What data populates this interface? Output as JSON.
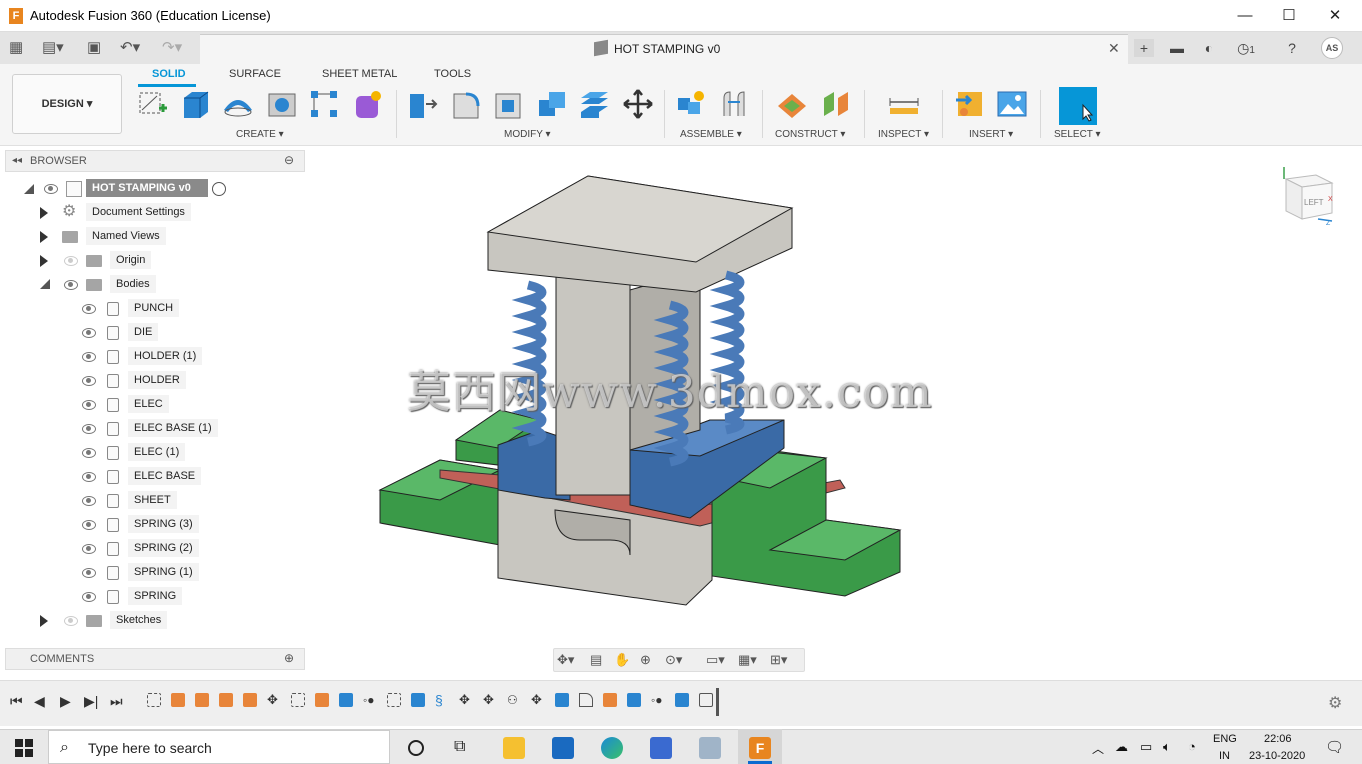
{
  "window": {
    "title": "Autodesk Fusion 360 (Education License)",
    "minimize": "—",
    "maximize": "☐",
    "close": "✕"
  },
  "document": {
    "title": "HOT STAMPING v0",
    "close": "✕"
  },
  "header": {
    "user_initials": "AS",
    "notifications_count": "1"
  },
  "workspace": {
    "label": "DESIGN ▾"
  },
  "tabs": [
    {
      "label": "SOLID"
    },
    {
      "label": "SURFACE"
    },
    {
      "label": "SHEET METAL"
    },
    {
      "label": "TOOLS"
    }
  ],
  "groups": {
    "create": "CREATE ▾",
    "modify": "MODIFY ▾",
    "assemble": "ASSEMBLE ▾",
    "construct": "CONSTRUCT ▾",
    "inspect": "INSPECT ▾",
    "insert": "INSERT ▾",
    "select": "SELECT ▾"
  },
  "browser": {
    "title": "BROWSER",
    "root": "HOT STAMPING v0",
    "nodes": {
      "document_settings": "Document Settings",
      "named_views": "Named Views",
      "origin": "Origin",
      "bodies": "Bodies",
      "sketches": "Sketches"
    },
    "bodies": [
      "PUNCH",
      "DIE",
      "HOLDER (1)",
      "HOLDER",
      "ELEC",
      "ELEC BASE (1)",
      "ELEC (1)",
      "ELEC BASE",
      "SHEET",
      "SPRING (3)",
      "SPRING (2)",
      "SPRING (1)",
      "SPRING"
    ]
  },
  "comments": {
    "title": "COMMENTS"
  },
  "viewcube": {
    "face": "LEFT",
    "axis_x": "X",
    "axis_z": "Z"
  },
  "watermark": "莫西网www.3dmox.com",
  "taskbar": {
    "search_placeholder": "Type here to search",
    "lang_top": "ENG",
    "lang_bottom": "IN",
    "time": "22:06",
    "date": "23-10-2020"
  },
  "colors": {
    "accent": "#0696d7",
    "app_orange": "#e8851f",
    "die_gray": "#c8c6c0",
    "holder_green": "#3a9a48",
    "elec_blue": "#3a6aa6",
    "sheet_red": "#c06058",
    "spring_blue": "#4a7ab8"
  }
}
